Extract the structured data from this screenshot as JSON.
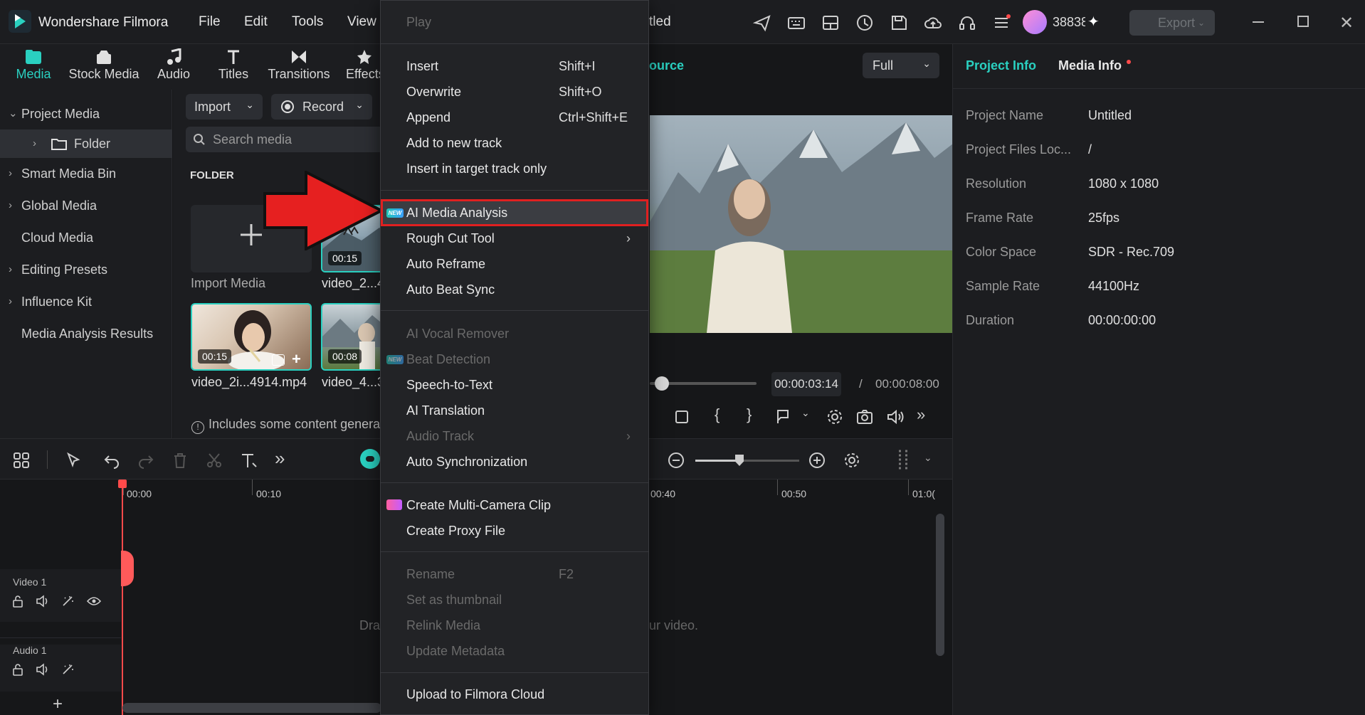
{
  "app": {
    "name": "Wondershare Filmora",
    "menus": [
      "File",
      "Edit",
      "Tools",
      "View"
    ],
    "project_title_fragment": "tled",
    "credits": "38838",
    "export_label": "Export"
  },
  "media_tabs": [
    "Media",
    "Stock Media",
    "Audio",
    "Titles",
    "Transitions",
    "Effects"
  ],
  "sidebar": {
    "items": [
      {
        "label": "Project Media",
        "chev": "v"
      },
      {
        "label": "Folder",
        "chev": ">"
      },
      {
        "label": "Smart Media Bin",
        "chev": ">"
      },
      {
        "label": "Global Media",
        "chev": ">"
      },
      {
        "label": "Cloud Media",
        "chev": ""
      },
      {
        "label": "Editing Presets",
        "chev": ">"
      },
      {
        "label": "Influence Kit",
        "chev": ">"
      },
      {
        "label": "Media Analysis Results",
        "chev": ""
      }
    ]
  },
  "browser": {
    "import_label": "Import",
    "record_label": "Record",
    "search_placeholder": "Search media",
    "folder_heading": "FOLDER",
    "import_media_label": "Import Media",
    "thumbs": [
      {
        "name": "video_2...4",
        "duration": "00:15"
      },
      {
        "name": "video_2i...4914.mp4",
        "duration": "00:15"
      },
      {
        "name": "video_4...3",
        "duration": "00:08"
      }
    ],
    "notice": "Includes some content genera"
  },
  "player": {
    "source_fragment": "ource",
    "quality": "Full",
    "current_time": "00:00:03:14",
    "separator": "/",
    "total_time": "00:00:08:00"
  },
  "right_panel": {
    "tabs": [
      "Project Info",
      "Media Info"
    ],
    "rows": [
      {
        "k": "Project Name",
        "v": "Untitled"
      },
      {
        "k": "Project Files Loc...",
        "v": "/"
      },
      {
        "k": "Resolution",
        "v": "1080 x 1080"
      },
      {
        "k": "Frame Rate",
        "v": "25fps"
      },
      {
        "k": "Color Space",
        "v": "SDR - Rec.709"
      },
      {
        "k": "Sample Rate",
        "v": "44100Hz"
      },
      {
        "k": "Duration",
        "v": "00:00:00:00"
      }
    ]
  },
  "timeline": {
    "ticks": [
      "00:00",
      "00:10",
      "00:40",
      "00:50",
      "01:0("
    ],
    "video_track": "Video 1",
    "audio_track": "Audio 1",
    "drop_hint_left": "Dra",
    "drop_hint_right": "ur video."
  },
  "context_menu": {
    "play": "Play",
    "group1": [
      {
        "label": "Insert",
        "shortcut": "Shift+I"
      },
      {
        "label": "Overwrite",
        "shortcut": "Shift+O"
      },
      {
        "label": "Append",
        "shortcut": "Ctrl+Shift+E"
      },
      {
        "label": "Add to new track",
        "shortcut": ""
      },
      {
        "label": "Insert in target track only",
        "shortcut": ""
      }
    ],
    "group2": [
      {
        "label": "AI Media Analysis",
        "badge": "NEW"
      },
      {
        "label": "Rough Cut Tool",
        "submenu": true
      },
      {
        "label": "Auto Reframe"
      },
      {
        "label": "Auto Beat Sync"
      }
    ],
    "group3": [
      {
        "label": "AI Vocal Remover",
        "disabled": true
      },
      {
        "label": "Beat Detection",
        "disabled": true,
        "badge": "NEW"
      },
      {
        "label": "Speech-to-Text"
      },
      {
        "label": "AI Translation"
      },
      {
        "label": "Audio Track",
        "disabled": true,
        "submenu": true
      },
      {
        "label": "Auto Synchronization"
      }
    ],
    "group4": [
      {
        "label": "Create Multi-Camera Clip"
      },
      {
        "label": "Create Proxy File"
      }
    ],
    "group5": [
      {
        "label": "Rename",
        "shortcut": "F2",
        "disabled": true
      },
      {
        "label": "Set as thumbnail",
        "disabled": true
      },
      {
        "label": "Relink Media",
        "disabled": true
      },
      {
        "label": "Update Metadata",
        "disabled": true
      }
    ],
    "upload": "Upload to Filmora Cloud"
  },
  "colors": {
    "accent": "#2ad0c0",
    "highlight_box": "#e02020",
    "arrow": "#e62020",
    "playhead": "#ff4a4a"
  }
}
